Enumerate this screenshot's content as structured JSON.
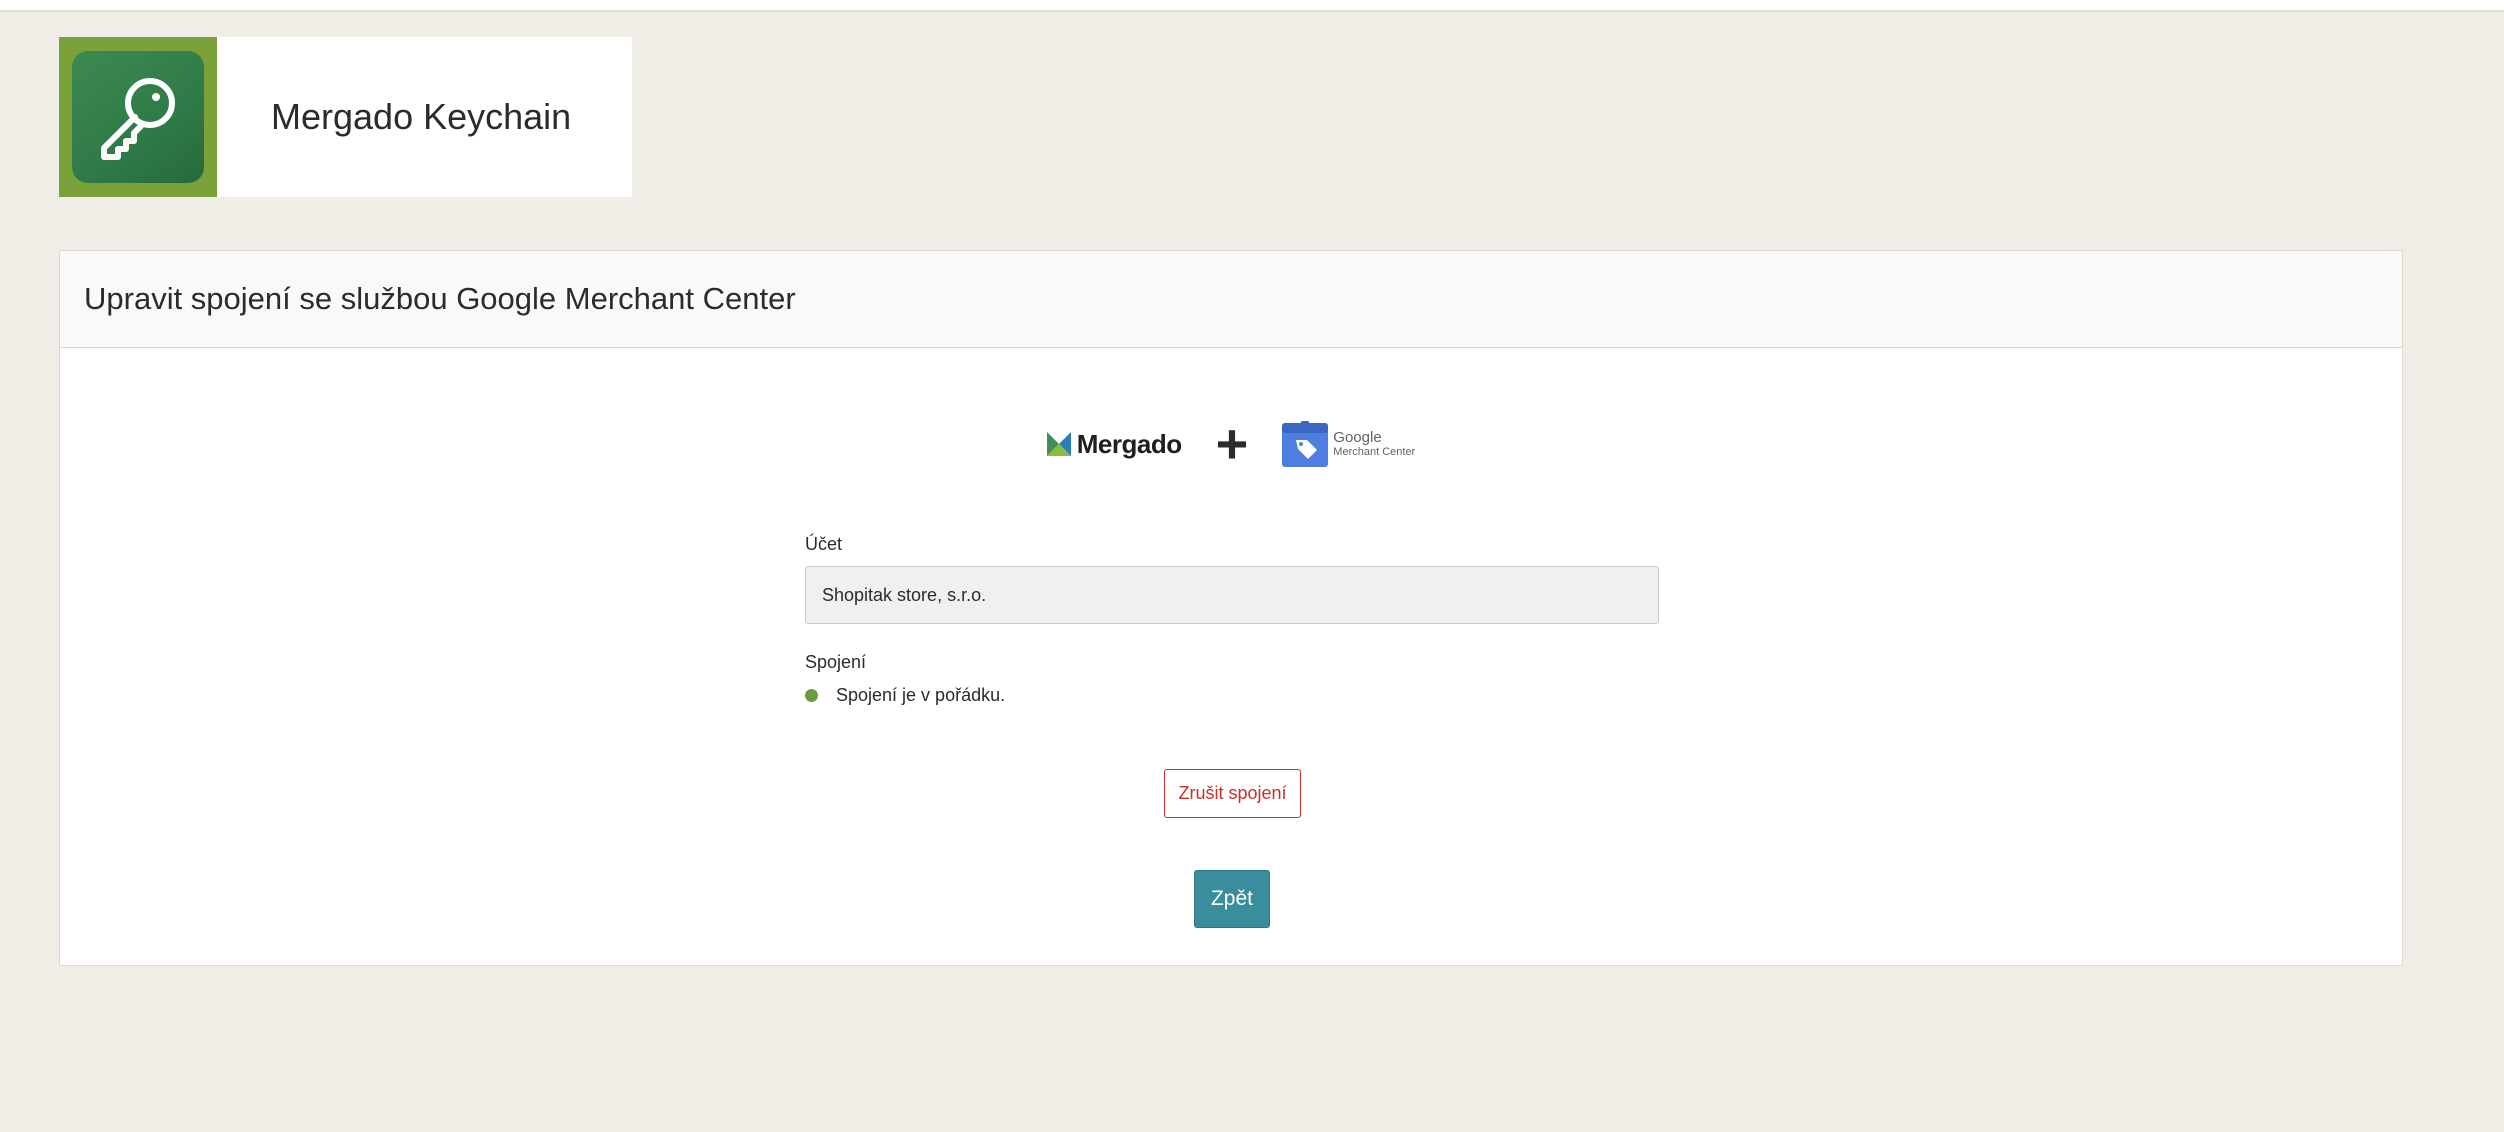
{
  "app": {
    "title": "Mergado Keychain",
    "logo_icon": "key-icon"
  },
  "panel": {
    "title": "Upravit spojení se službou Google Merchant Center"
  },
  "logos": {
    "mergado_text": "Mergado",
    "plus": "+",
    "gmc_top": "Google",
    "gmc_bottom": "Merchant Center"
  },
  "form": {
    "account_label": "Účet",
    "account_value": "Shopitak store, s.r.o.",
    "connection_label": "Spojení",
    "connection_status": "Spojení je v pořádku."
  },
  "actions": {
    "cancel_label": "Zrušit spojení",
    "back_label": "Zpět"
  },
  "colors": {
    "background": "#f0ede6",
    "logo_green": "#7aa13a",
    "status_ok": "#6e9c3c",
    "danger": "#c9302c",
    "primary": "#3a8d9c"
  }
}
